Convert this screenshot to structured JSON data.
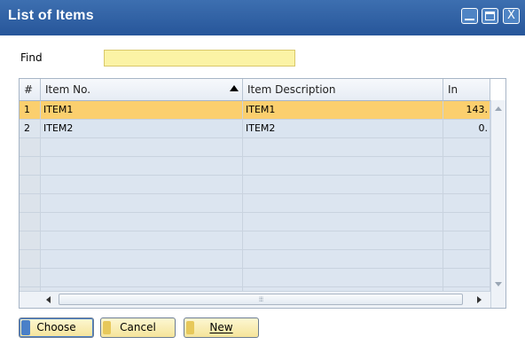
{
  "window": {
    "title": "List of Items",
    "controls": {
      "minimize": "minimize",
      "maximize": "maximize",
      "close": "X"
    }
  },
  "find": {
    "label": "Find",
    "value": "",
    "placeholder": ""
  },
  "table": {
    "columns": [
      {
        "key": "num",
        "label": "#"
      },
      {
        "key": "item_no",
        "label": "Item No.",
        "sorted": "ascending"
      },
      {
        "key": "item_desc",
        "label": "Item Description"
      },
      {
        "key": "in_stock",
        "label": "In Stock"
      }
    ],
    "rows": [
      {
        "num": "1",
        "item_no": "ITEM1",
        "item_desc": "ITEM1",
        "in_stock": "143.",
        "selected": true
      },
      {
        "num": "2",
        "item_no": "ITEM2",
        "item_desc": "ITEM2",
        "in_stock": "0.",
        "selected": false
      }
    ],
    "empty_rows": 9
  },
  "buttons": {
    "choose": "Choose",
    "cancel": "Cancel",
    "new": "New"
  },
  "colors": {
    "title_bar": "#2f5fa3",
    "find_input": "#fbf3a5",
    "selected_row": "#fbcf6e",
    "row": "#dae4f0",
    "button": "#f5e49a"
  },
  "icons": {
    "sort": "sort-ascending-icon",
    "scroll_left": "arrow-left-icon",
    "scroll_right": "arrow-right-icon",
    "scroll_up": "arrow-up-icon",
    "scroll_down": "arrow-down-icon"
  }
}
